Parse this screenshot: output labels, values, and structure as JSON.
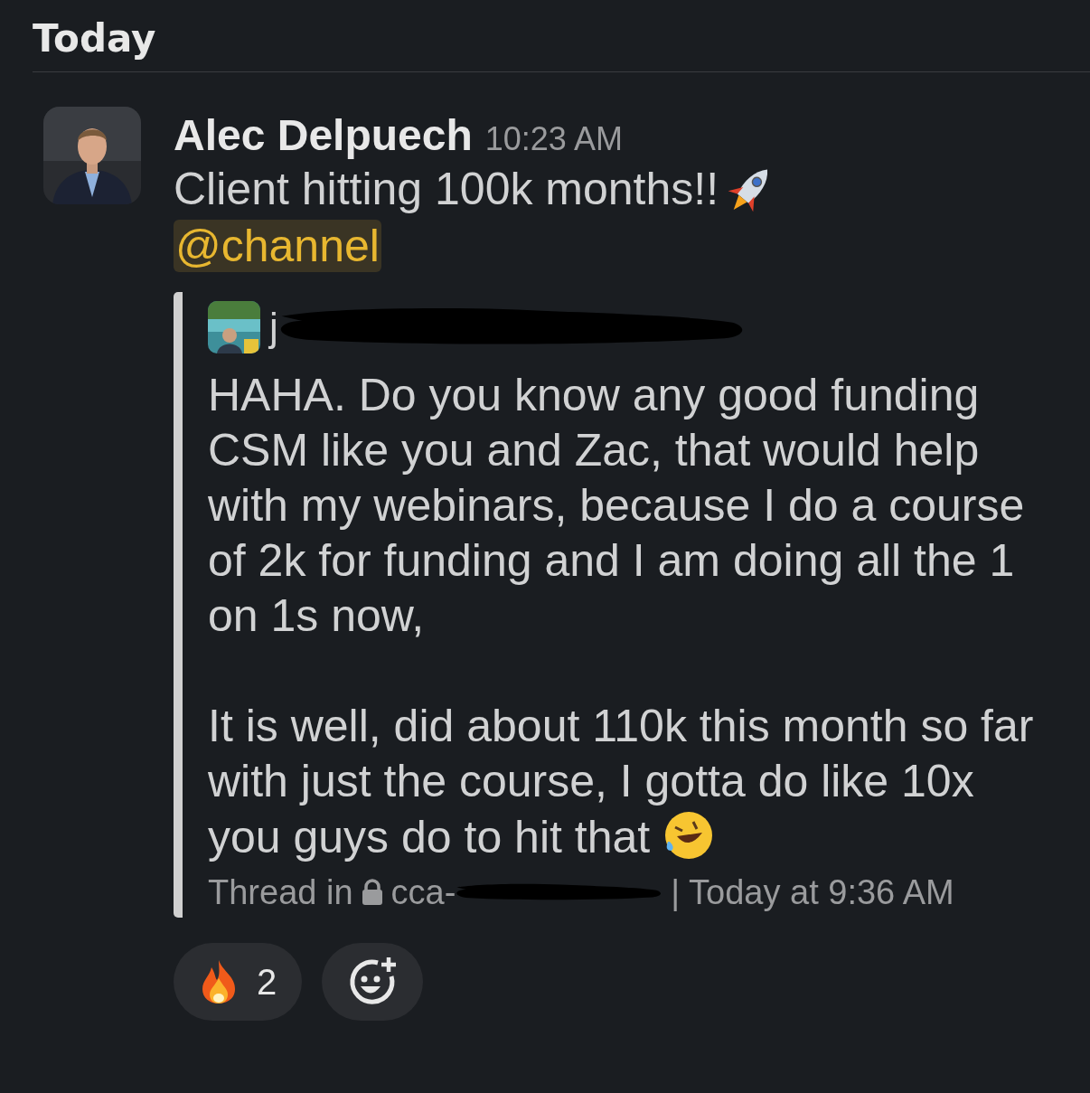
{
  "divider": {
    "label": "Today"
  },
  "message": {
    "author": "Alec Delpuech",
    "time": "10:23 AM",
    "text": "Client hitting 100k months!!",
    "mention": "@channel",
    "shared": {
      "author": "j",
      "author_redacted": true,
      "paragraphs": [
        "HAHA. Do you know any good funding CSM like you and Zac, that would help with my webinars, because I do a course of 2k for funding and I am doing all the 1 on 1s now,",
        "It is well, did about 110k this month so far with just the course, I gotta do like 10x you guys do to hit that"
      ],
      "footer_prefix": "Thread in",
      "channel": "cca-",
      "channel_redacted": true,
      "footer_suffix": "| Today at 9:36 AM"
    },
    "reactions": [
      {
        "count": "2",
        "selected": false
      }
    ]
  }
}
